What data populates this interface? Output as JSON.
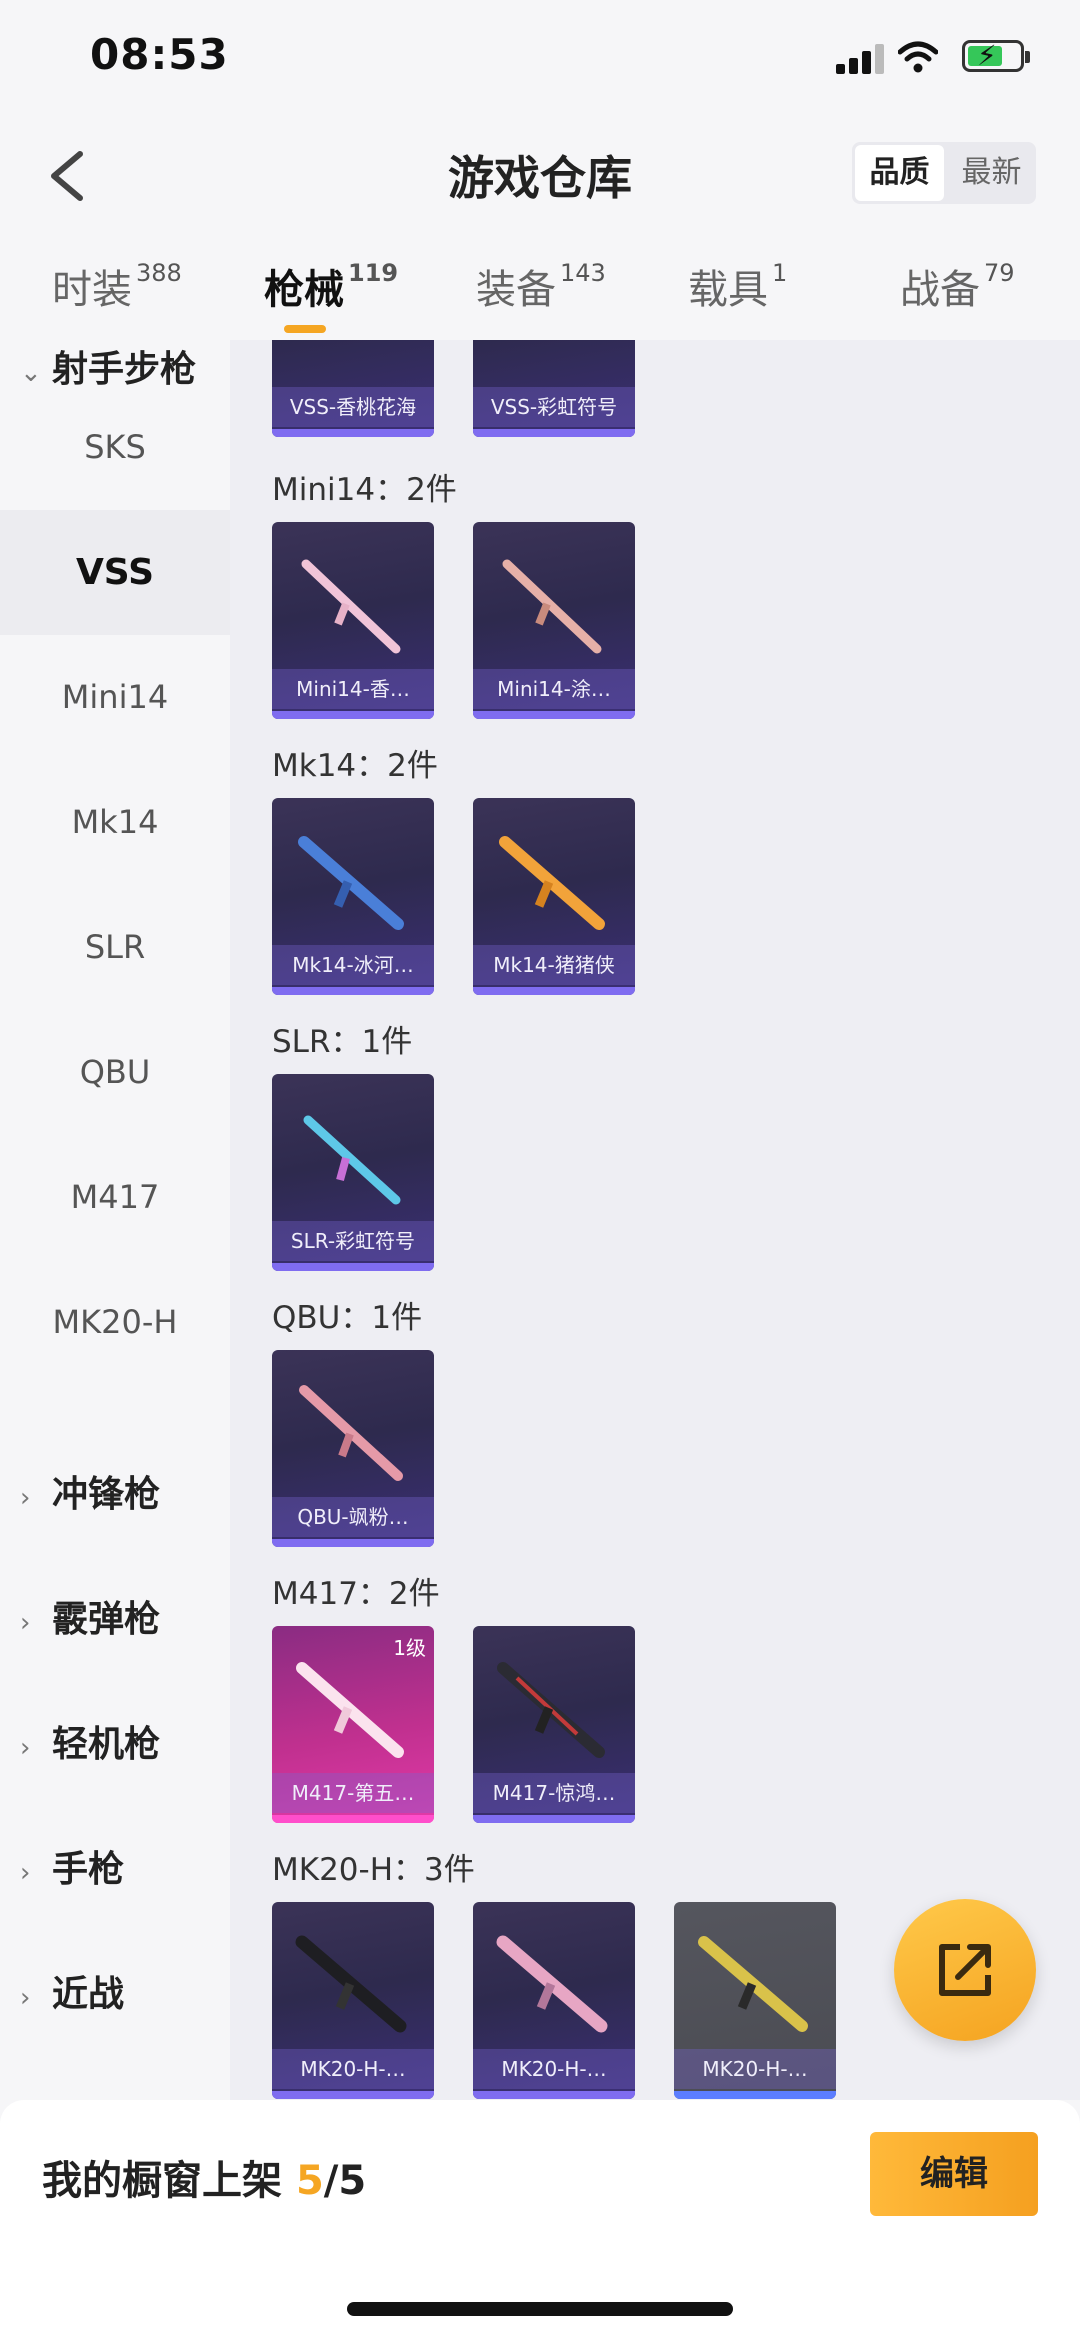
{
  "status": {
    "time": "08:53"
  },
  "header": {
    "title": "游戏仓库",
    "sort_options": [
      "品质",
      "最新"
    ]
  },
  "tabs": [
    {
      "label": "时装",
      "count": "388"
    },
    {
      "label": "枪械",
      "count": "119"
    },
    {
      "label": "装备",
      "count": "143"
    },
    {
      "label": "载具",
      "count": "1"
    },
    {
      "label": "战备",
      "count": "79"
    }
  ],
  "sidebar": {
    "expanded_group": "射手步枪",
    "items": [
      "SKS",
      "VSS",
      "Mini14",
      "Mk14",
      "SLR",
      "QBU",
      "M417",
      "MK20-H"
    ],
    "groups": [
      "冲锋枪",
      "霰弹枪",
      "轻机枪",
      "手枪",
      "近战"
    ]
  },
  "content": {
    "top_cards": [
      "VSS-香桃花海",
      "VSS-彩虹符号"
    ],
    "sections": [
      {
        "title": "Mini14：2件",
        "cards": [
          "Mini14-香…",
          "Mini14-涂…"
        ]
      },
      {
        "title": "Mk14：2件",
        "cards": [
          "Mk14-冰河…",
          "Mk14-猪猪侠"
        ]
      },
      {
        "title": "SLR：1件",
        "cards": [
          "SLR-彩虹符号"
        ]
      },
      {
        "title": "QBU：1件",
        "cards": [
          "QBU-飒粉…"
        ]
      },
      {
        "title": "M417：2件",
        "cards": [
          "M417-第五…",
          "M417-惊鸿…"
        ],
        "level_badge": "1级"
      },
      {
        "title": "MK20-H：3件",
        "cards": [
          "MK20-H-…",
          "MK20-H-…",
          "MK20-H-…"
        ]
      }
    ]
  },
  "bottom": {
    "label": "我的橱窗上架",
    "current": "5",
    "total": "/5",
    "edit_label": "编辑"
  },
  "colors": {
    "accent": "#f5a623",
    "card_purple": "#3b2f76",
    "card_pink": "#e43aa9",
    "card_grey": "#4a4b52"
  }
}
